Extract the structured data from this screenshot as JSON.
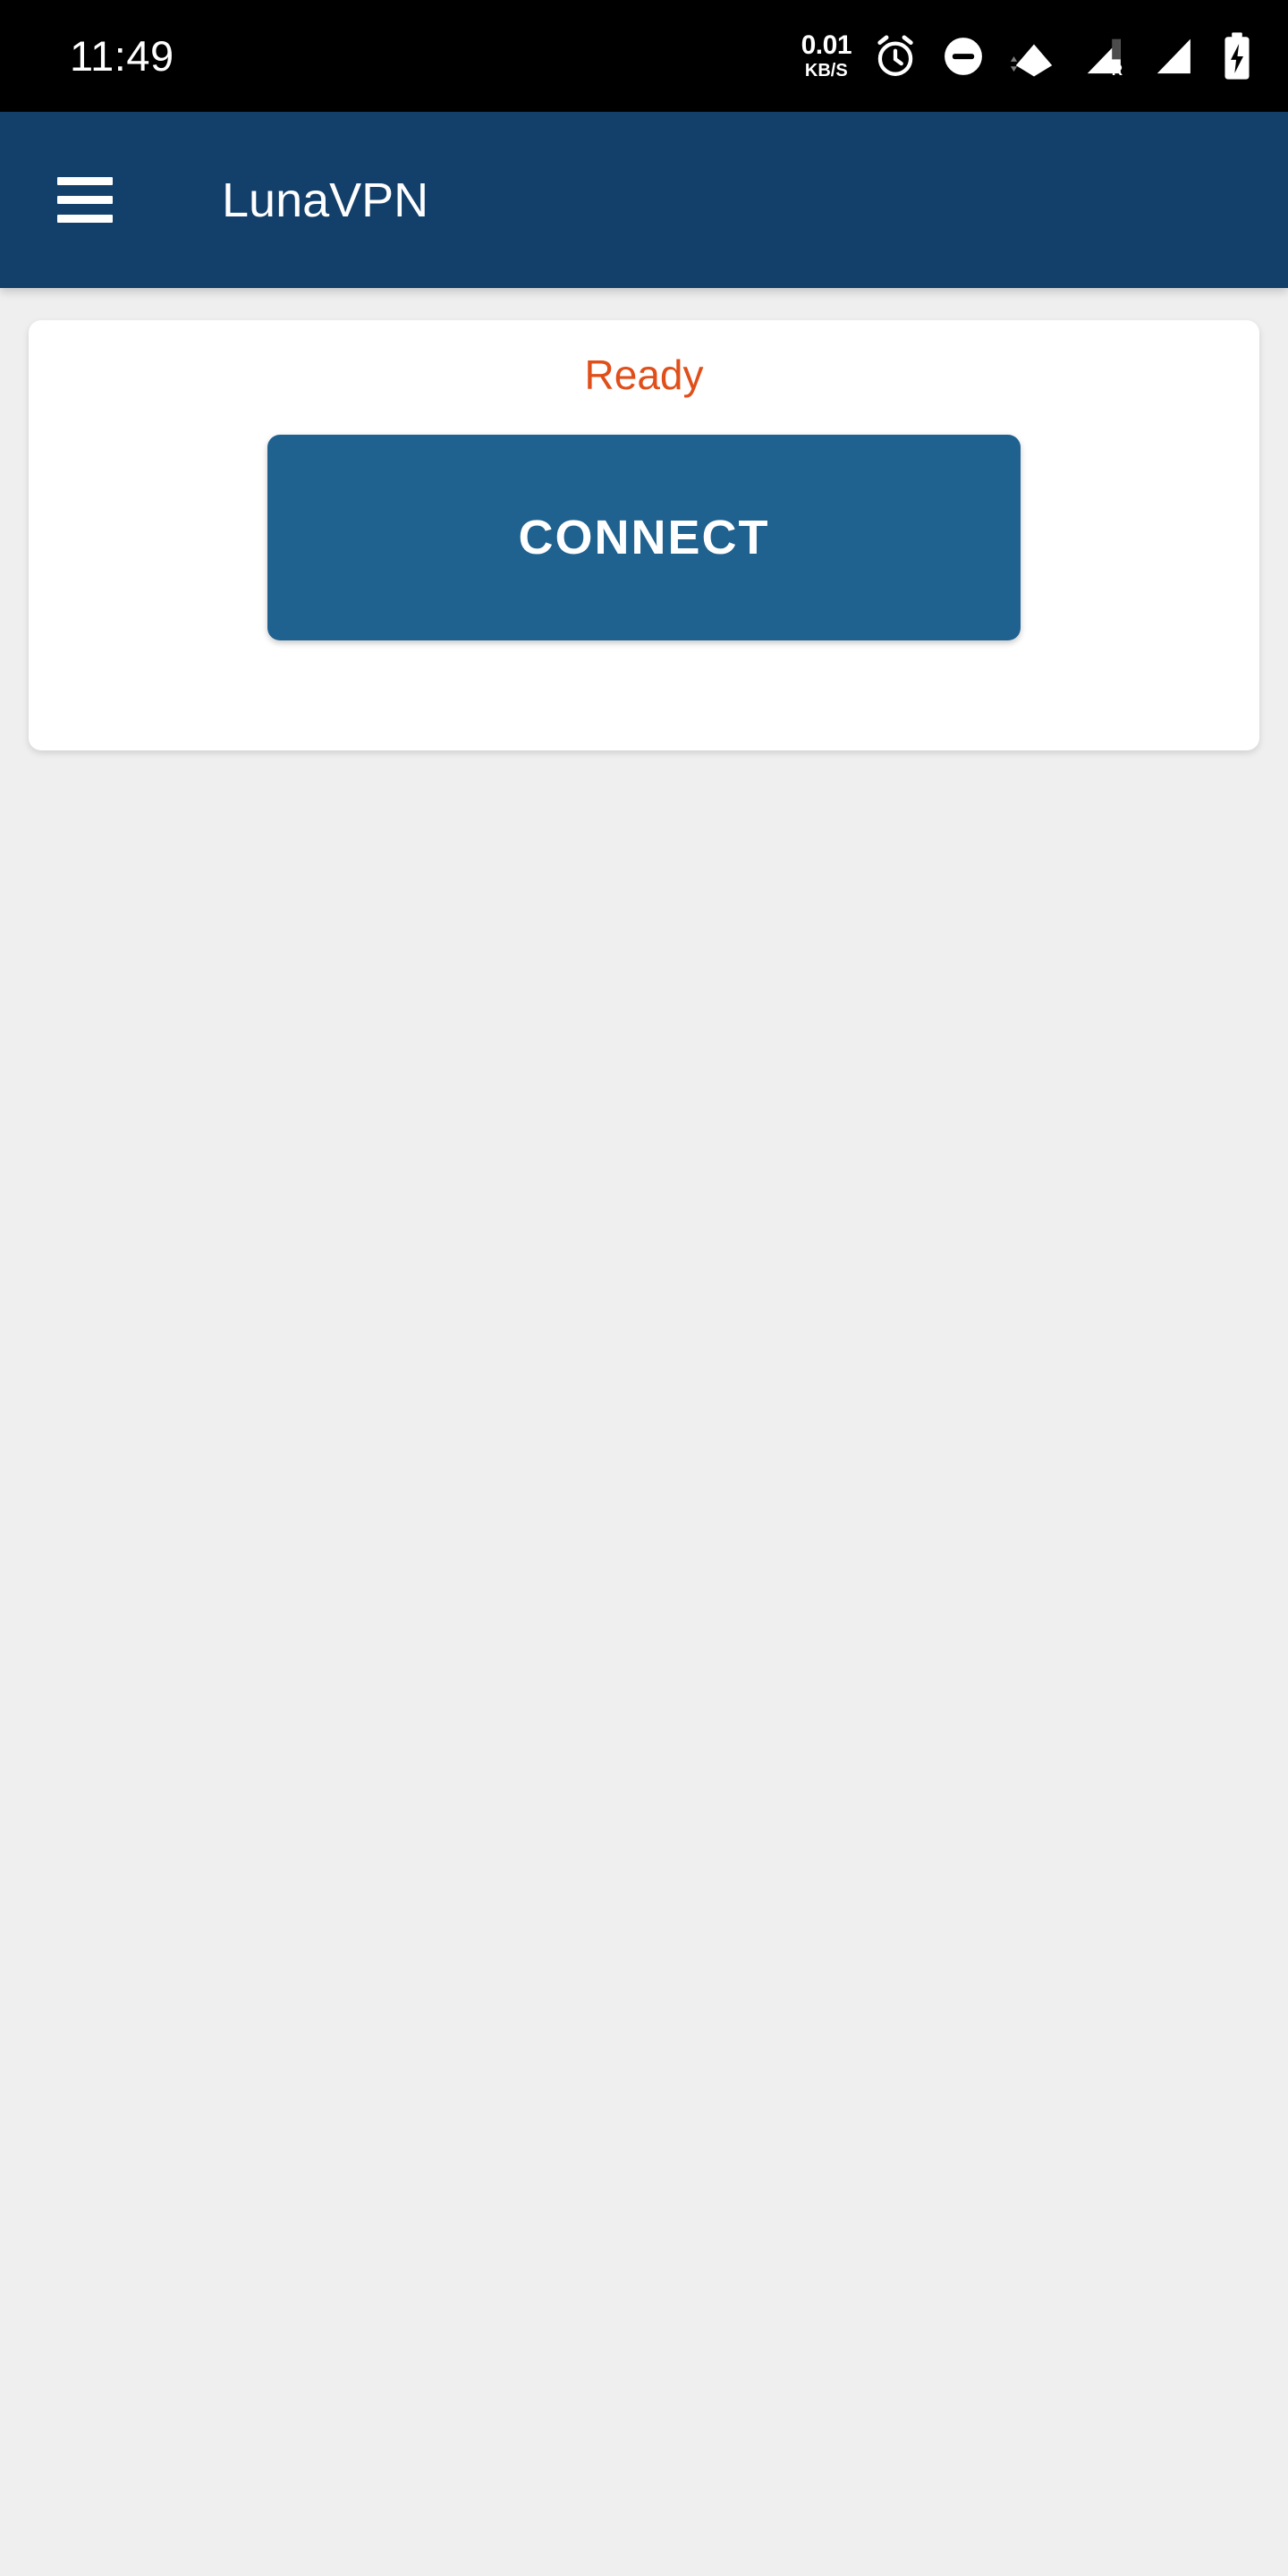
{
  "status_bar": {
    "clock": "11:49",
    "network_speed": {
      "rate": "0.01",
      "unit": "KB/S"
    },
    "icons": [
      {
        "name": "network-speed-indicator",
        "label": "0.01 KB/S"
      },
      {
        "name": "alarm-clock-icon",
        "label": "Alarm set"
      },
      {
        "name": "do-not-disturb-icon",
        "label": "Do not disturb"
      },
      {
        "name": "wifi-icon",
        "label": "Wi-Fi connected"
      },
      {
        "name": "cellular-signal-roaming-icon",
        "label": "R"
      },
      {
        "name": "cellular-signal-icon",
        "label": "Signal"
      },
      {
        "name": "battery-charging-icon",
        "label": "Charging"
      }
    ]
  },
  "app_bar": {
    "menu_label": "Open navigation menu",
    "title": "LunaVPN",
    "background_color": "#12406a"
  },
  "main": {
    "card": {
      "status_text": "Ready",
      "status_color": "#e04e19",
      "connect_button_label": "CONNECT",
      "connect_button_color": "#1f618f"
    },
    "background_color": "#efefef"
  }
}
